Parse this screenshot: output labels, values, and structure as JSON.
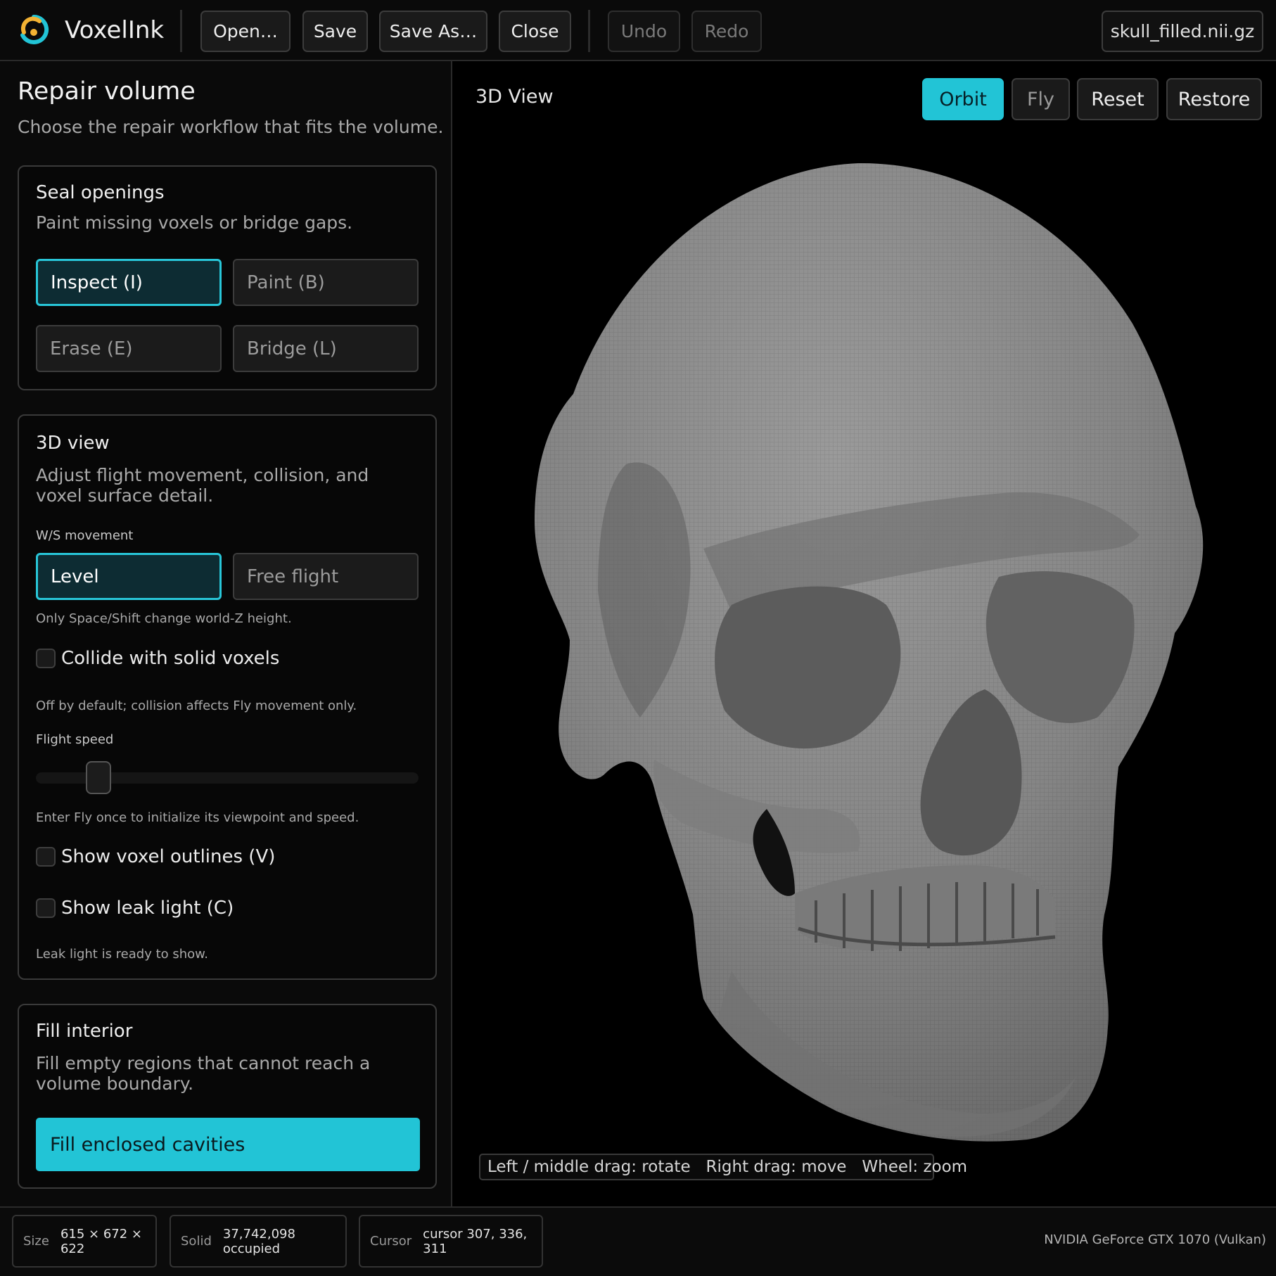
{
  "app": {
    "name": "VoxelInk"
  },
  "toolbar": {
    "open_label": "Open…",
    "save_label": "Save",
    "save_as_label": "Save As…",
    "close_label": "Close",
    "undo_label": "Undo",
    "redo_label": "Redo",
    "file_name": "skull_filled.nii.gz"
  },
  "sidebar": {
    "title": "Repair volume",
    "subtitle": "Choose the repair workflow that fits the volume.",
    "seal": {
      "title": "Seal openings",
      "desc": "Paint missing voxels or bridge gaps.",
      "tools": [
        "Inspect (I)",
        "Paint (B)",
        "Erase (E)",
        "Bridge (L)"
      ],
      "active_tool": "Inspect (I)"
    },
    "view3d": {
      "title": "3D view",
      "desc": "Adjust flight movement, collision, and voxel surface detail.",
      "ws_label": "W/S movement",
      "ws_options": [
        "Level",
        "Free flight"
      ],
      "ws_selected": "Level",
      "ws_hint": "Only Space/Shift change world-Z height.",
      "collide_label": "Collide with solid voxels",
      "collide_checked": false,
      "collide_hint": "Off by default; collision affects Fly movement only.",
      "speed_label": "Flight speed",
      "speed_value_fraction": 0.14,
      "speed_hint": "Enter Fly once to initialize its viewpoint and speed.",
      "outlines_label": "Show voxel outlines (V)",
      "outlines_checked": false,
      "leak_label": "Show leak light (C)",
      "leak_checked": false,
      "leak_hint": "Leak light is ready to show."
    },
    "fill": {
      "title": "Fill interior",
      "desc": "Fill empty regions that cannot reach a volume boundary.",
      "button_label": "Fill enclosed cavities"
    }
  },
  "viewport": {
    "title": "3D View",
    "modes": [
      "Orbit",
      "Fly"
    ],
    "active_mode": "Orbit",
    "reset_label": "Reset",
    "restore_label": "Restore",
    "hint": "Left / middle drag: rotate   Right drag: move   Wheel: zoom"
  },
  "status": {
    "size_key": "Size",
    "size_value": "615 × 672 × 622",
    "solid_key": "Solid",
    "solid_value": "37,742,098 occupied",
    "cursor_key": "Cursor",
    "cursor_value": "cursor 307, 336, 311",
    "gpu": "NVIDIA GeForce GTX 1070 (Vulkan)"
  },
  "colors": {
    "accent": "#22c4d6",
    "background": "#000000",
    "panel": "#0a0a0a",
    "skull": "#8a8a8a"
  }
}
